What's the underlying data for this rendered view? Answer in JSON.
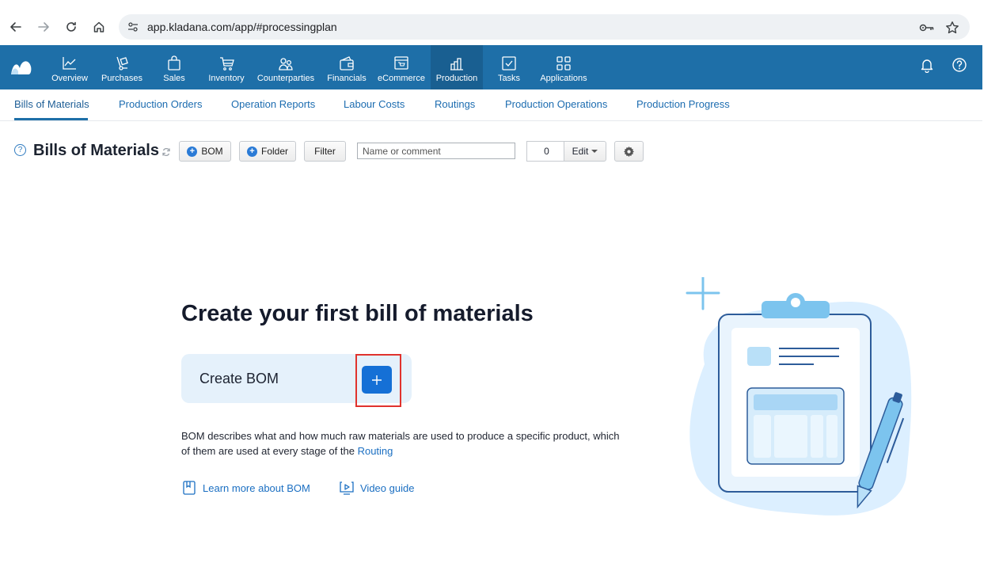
{
  "browser": {
    "url": "app.kladana.com/app/#processingplan",
    "icons": [
      "back-arrow-icon",
      "forward-arrow-icon",
      "reload-icon",
      "home-icon",
      "site-info-icon",
      "password-key-icon",
      "bookmark-star-icon"
    ]
  },
  "top_nav": {
    "items": [
      {
        "label": "Overview",
        "icon": "chart-line-icon"
      },
      {
        "label": "Purchases",
        "icon": "hand-truck-icon"
      },
      {
        "label": "Sales",
        "icon": "shopping-bag-icon"
      },
      {
        "label": "Inventory",
        "icon": "cart-icon"
      },
      {
        "label": "Counterparties",
        "icon": "people-icon"
      },
      {
        "label": "Financials",
        "icon": "wallet-icon"
      },
      {
        "label": "eCommerce",
        "icon": "storefront-icon"
      },
      {
        "label": "Production",
        "icon": "factory-icon"
      },
      {
        "label": "Tasks",
        "icon": "checkbox-icon"
      },
      {
        "label": "Applications",
        "icon": "apps-grid-icon"
      }
    ],
    "active": "Production",
    "right_icons": [
      "bell-icon",
      "help-icon"
    ]
  },
  "sub_nav": {
    "items": [
      "Bills of Materials",
      "Production Orders",
      "Operation Reports",
      "Labour Costs",
      "Routings",
      "Production Operations",
      "Production Progress"
    ],
    "active": "Bills of Materials"
  },
  "toolbar": {
    "title": "Bills of Materials",
    "bom_button": "BOM",
    "folder_button": "Folder",
    "filter_button": "Filter",
    "search_placeholder": "Name or comment",
    "count": "0",
    "edit_button": "Edit"
  },
  "empty_state": {
    "heading": "Create your first bill of materials",
    "create_label": "Create BOM",
    "description": "BOM describes what and how much raw materials are used to produce a specific product, which of them are used at every stage of the ",
    "description_link": "Routing",
    "learn_more": "Learn more about BOM",
    "video_guide": "Video guide"
  },
  "colors": {
    "nav_bg": "#1e6fa8",
    "nav_active": "#195f91",
    "link": "#1b6fc2",
    "create_button": "#1570d6",
    "highlight": "#e0322d"
  }
}
